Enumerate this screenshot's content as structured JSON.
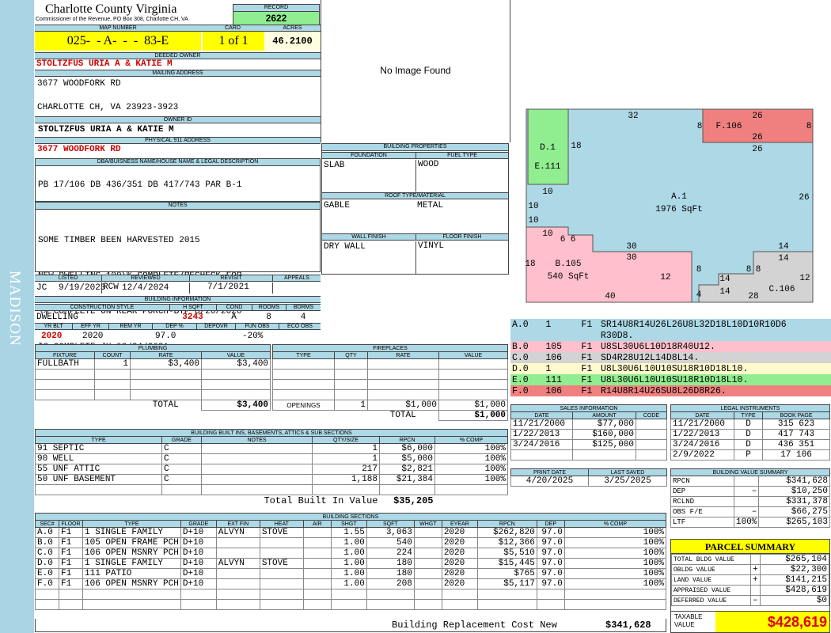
{
  "county": "Charlotte County Virginia",
  "commissioner": "Commissioner of the Revenue, PO Box 308, Charlotte CH, VA",
  "side_label": "MADISON",
  "record": {
    "label": "RECORD",
    "value": "2622"
  },
  "map": {
    "label": "MAP NUMBER",
    "value": "025-  - A-  -  -  83-E"
  },
  "card": {
    "label": "CARD",
    "value": "1 of 1"
  },
  "acres": {
    "label": "ACRES",
    "value": "46.2100"
  },
  "deeded": {
    "label": "DEEDED OWNER",
    "value": "STOLTZFUS URIA A & KATIE M"
  },
  "mailing": {
    "label": "MAILING ADDRESS",
    "line1": "3677 WOODFORK RD",
    "line2": "CHARLOTTE CH, VA 23923-3923"
  },
  "owner_id": {
    "label": "OWNER ID",
    "value": "STOLTZFUS URIA A & KATIE M"
  },
  "physical": {
    "label": "PHYSICAL 911 ADDRESS",
    "value": "3677 WOODFORK RD"
  },
  "dba": {
    "label": "DBA/BUISNESS NAME/HOUSE NAME & LEGAL DESCRIPTION",
    "value": "PB 17/106 DB 436/351 DB 417/743 PAR B-1"
  },
  "notes": {
    "label": "NOTES",
    "lines": [
      "SOME TIMBER BEEN HARVESTED 2015",
      "NEW DWELLING 100\\% COMPLETE/RECHECK FOR",
      "\\% COMPLETE ON REAR PORCH-BTP 8/26/2020",
      "IS COMPLETE-JH 08/24/2021"
    ]
  },
  "photo_text": "No Image Found",
  "bp": {
    "label": "BUILDING PROPERTIES",
    "foundation_label": "FOUNDATION",
    "fuel_label": "FUEL TYPE",
    "foundation": "SLAB",
    "fuel": "WOOD",
    "roof_label": "ROOF TYPE/MATERIAL",
    "roof_type": "GABLE",
    "roof_mat": "METAL",
    "wall_label": "WALL FINISH",
    "floor_label": "FLOOR FINISH",
    "wall": "DRY WALL",
    "floor": "VINYL"
  },
  "status": {
    "listed_label": "LISTED",
    "listed_by": "JC",
    "listed_date": "9/19/2023",
    "reviewed_label": "REVIEWED",
    "reviewed_by": "RCW",
    "reviewed_date": "12/4/2024",
    "revisit_label": "REVISIT",
    "revisit": "7/1/2021",
    "appeals_label": "APPEALS",
    "appeals": ""
  },
  "bi": {
    "label": "BUILDING INFORMATION",
    "style_label": "CONSTRUCTION STYLE",
    "hsqft_label": "H SQFT",
    "cond_label": "COND",
    "rooms_label": "ROOMS",
    "bdrms_label": "BDRMS",
    "style": "DWELLING",
    "hsqft": "3243",
    "cond": "A",
    "rooms": "8",
    "bdrms": "4",
    "yrblt_label": "YR BLT",
    "effyr_label": "EFF YR",
    "remyr_label": "REM YR",
    "dep_label": "DEP %",
    "depovr_label": "DEPOVR",
    "funobs_label": "FUN OBS",
    "ecoobs_label": "ECO OBS",
    "yrblt": "2020",
    "effyr": "2020",
    "remyr": "",
    "dep": "97.0",
    "depovr": "",
    "funobs": "-20%",
    "ecoobs": ""
  },
  "plumbing": {
    "label": "PLUMBING",
    "cols": [
      "FIXTURE",
      "COUNT",
      "RATE",
      "VALUE"
    ],
    "rows": [
      [
        "FULLBATH",
        "1",
        "$3,400",
        "$3,400"
      ]
    ],
    "total_label": "TOTAL",
    "total": "$3,400"
  },
  "fireplaces": {
    "label": "FIREPLACES",
    "cols": [
      "TYPE",
      "QTY",
      "RATE",
      "VALUE"
    ],
    "openings_label": "OPENINGS",
    "openings": [
      "1",
      "$1,000",
      "$1,000"
    ],
    "total_label": "TOTAL",
    "total": "$1,000"
  },
  "builtins": {
    "label": "BUILDING BUILT INS, BASEMENTS, ATTICS & SUB SECTIONS",
    "cols": [
      "TYPE",
      "GRADE",
      "NOTES",
      "QTY/SIZE",
      "RPCN",
      "% COMP"
    ],
    "rows": [
      [
        "91 SEPTIC",
        "C",
        "",
        "1",
        "$6,000",
        "100%"
      ],
      [
        "90 WELL",
        "C",
        "",
        "1",
        "$5,000",
        "100%"
      ],
      [
        "55 UNF ATTIC",
        "C",
        "",
        "217",
        "$2,821",
        "100%"
      ],
      [
        "50 UNF BASEMENT",
        "C",
        "",
        "1,188",
        "$21,384",
        "100%"
      ]
    ],
    "total_label": "Total Built In Value",
    "total": "$35,205"
  },
  "sections": {
    "label": "BUILDING SECTIONS",
    "cols": [
      "SEC#",
      "FLOOR",
      "TYPE",
      "GRADE",
      "EXT FIN",
      "HEAT",
      "AIR",
      "SHGT",
      "SQFT",
      "WHGT",
      "EYEAR",
      "RPCN",
      "DEP",
      "% COMP"
    ],
    "rows": [
      [
        "A.0",
        "F1",
        "1 SINGLE FAMILY",
        "D+10",
        "ALVYN",
        "STOVE",
        "",
        "1.55",
        "3,063",
        "",
        "2020",
        "$262,820",
        "97.0",
        "100%"
      ],
      [
        "B.0",
        "F1",
        "105 OPEN FRAME PCH",
        "D+10",
        "",
        "",
        "",
        "1.00",
        "540",
        "",
        "2020",
        "$12,366",
        "97.0",
        "100%"
      ],
      [
        "C.0",
        "F1",
        "106 OPEN MSNRY PCH",
        "D+10",
        "",
        "",
        "",
        "1.00",
        "224",
        "",
        "2020",
        "$5,510",
        "97.0",
        "100%"
      ],
      [
        "D.0",
        "F1",
        "1 SINGLE FAMILY",
        "D+10",
        "ALVYN",
        "STOVE",
        "",
        "1.00",
        "180",
        "",
        "2020",
        "$15,445",
        "97.0",
        "100%"
      ],
      [
        "E.0",
        "F1",
        "111 PATIO",
        "D+10",
        "",
        "",
        "",
        "1.00",
        "180",
        "",
        "2020",
        "$765",
        "97.0",
        "100%"
      ],
      [
        "F.0",
        "F1",
        "106 OPEN MSNRY PCH",
        "D+10",
        "",
        "",
        "",
        "1.00",
        "208",
        "",
        "2020",
        "$5,117",
        "97.0",
        "100%"
      ]
    ],
    "total_label": "Building Replacement Cost New",
    "total": "$341,628"
  },
  "sketch": {
    "labels": [
      {
        "t": "32",
        "k": "t"
      },
      {
        "t": "26",
        "k": "t"
      },
      {
        "t": "8",
        "k": "t"
      },
      {
        "t": "F.106",
        "k": "t"
      },
      {
        "t": "8",
        "k": "t"
      },
      {
        "t": "26",
        "k": "t"
      },
      {
        "t": "26",
        "k": "t"
      },
      {
        "t": "D.1",
        "k": "t"
      },
      {
        "t": "18",
        "k": "t"
      },
      {
        "t": "E.111",
        "k": "t"
      },
      {
        "t": "10",
        "k": "t"
      },
      {
        "t": "10",
        "k": "t"
      },
      {
        "t": "A.1",
        "k": "t"
      },
      {
        "t": "1976 SqFt",
        "k": "t"
      },
      {
        "t": "26",
        "k": "t"
      },
      {
        "t": "10",
        "k": "t"
      },
      {
        "t": "10",
        "k": "t"
      },
      {
        "t": "6",
        "k": "t"
      },
      {
        "t": "6",
        "k": "t"
      },
      {
        "t": "30",
        "k": "t"
      },
      {
        "t": "30",
        "k": "t"
      },
      {
        "t": "14",
        "k": "t"
      },
      {
        "t": "14",
        "k": "t"
      },
      {
        "t": "18",
        "k": "t"
      },
      {
        "t": "B.105",
        "k": "t"
      },
      {
        "t": "540 SqFt",
        "k": "t"
      },
      {
        "t": "12",
        "k": "t"
      },
      {
        "t": "8",
        "k": "t"
      },
      {
        "t": "14",
        "k": "t"
      },
      {
        "t": "8",
        "k": "t"
      },
      {
        "t": "8",
        "k": "t"
      },
      {
        "t": "12",
        "k": "t"
      },
      {
        "t": "C.106",
        "k": "t"
      },
      {
        "t": "40",
        "k": "t"
      },
      {
        "t": "4",
        "k": "t"
      },
      {
        "t": "14",
        "k": "t"
      },
      {
        "t": "28",
        "k": "t"
      }
    ]
  },
  "segments": [
    {
      "sec": "A.0",
      "num": "1",
      "fl": "F1",
      "code": "SR14U8R14U26L26U8L32D18L10D10R10D6",
      "code2": "R30D8.",
      "color": "#add8e6"
    },
    {
      "sec": "B.0",
      "num": "105",
      "fl": "F1",
      "code": "U8SL30U6L10D18R40U12.",
      "color": "#ffc0cb"
    },
    {
      "sec": "C.0",
      "num": "106",
      "fl": "F1",
      "code": "SD4R28U12L14D8L14.",
      "color": "#d3d3d3"
    },
    {
      "sec": "D.0",
      "num": "1",
      "fl": "F1",
      "code": "U8L30U6L10U10SU18R10D18L10.",
      "color": "#fffacd"
    },
    {
      "sec": "E.0",
      "num": "111",
      "fl": "F1",
      "code": "U8L30U6L10U10SU18R10D18L10.",
      "color": "#90ee90"
    },
    {
      "sec": "F.0",
      "num": "106",
      "fl": "F1",
      "code": "R14U8R14U26SU8L26D8R26.",
      "color": "#f08080"
    }
  ],
  "sales": {
    "label": "SALES INFORMATION",
    "cols": [
      "DATE",
      "AMOUNT",
      "CODE"
    ],
    "rows": [
      [
        "11/21/2000",
        "$77,000",
        ""
      ],
      [
        "1/22/2013",
        "$160,000",
        ""
      ],
      [
        "3/24/2016",
        "$125,000",
        ""
      ]
    ]
  },
  "legal": {
    "label": "LEGAL INSTRUMENTS",
    "cols": [
      "DATE",
      "TYPE",
      "BOOK PAGE"
    ],
    "rows": [
      [
        "11/21/2000",
        "D",
        "315 623"
      ],
      [
        "1/22/2013",
        "D",
        "417 743"
      ],
      [
        "3/24/2016",
        "D",
        "436 351"
      ],
      [
        "2/9/2022",
        "P",
        "17 106"
      ]
    ]
  },
  "print": {
    "label": "PRINT DATE",
    "value": "4/20/2025",
    "saved_label": "LAST SAVED",
    "saved": "3/25/2025"
  },
  "bvs": {
    "label": "BUILDING VALUE SUMMARY",
    "rows": [
      [
        "RPCN",
        "",
        "$341,628"
      ],
      [
        "DEP",
        "–",
        "$10,250"
      ],
      [
        "RCLND",
        "",
        "$331,378"
      ],
      [
        "OBS F/E",
        "–",
        "$66,275"
      ],
      [
        "LTF",
        "100%",
        "$265,103"
      ]
    ]
  },
  "parcel": {
    "label": "PARCEL SUMMARY",
    "rows": [
      [
        "TOTAL BLDG VALUE",
        "",
        "$265,104"
      ],
      [
        "OBLDG VALUE",
        "+",
        "$22,300"
      ],
      [
        "LAND VALUE",
        "+",
        "$141,215"
      ],
      [
        "APPRAISED VALUE",
        "",
        "$428,619"
      ],
      [
        "DEFERRED VALUE",
        "–",
        "$0"
      ]
    ],
    "taxable_label": "TAXABLE VALUE",
    "taxable": "$428,619"
  }
}
